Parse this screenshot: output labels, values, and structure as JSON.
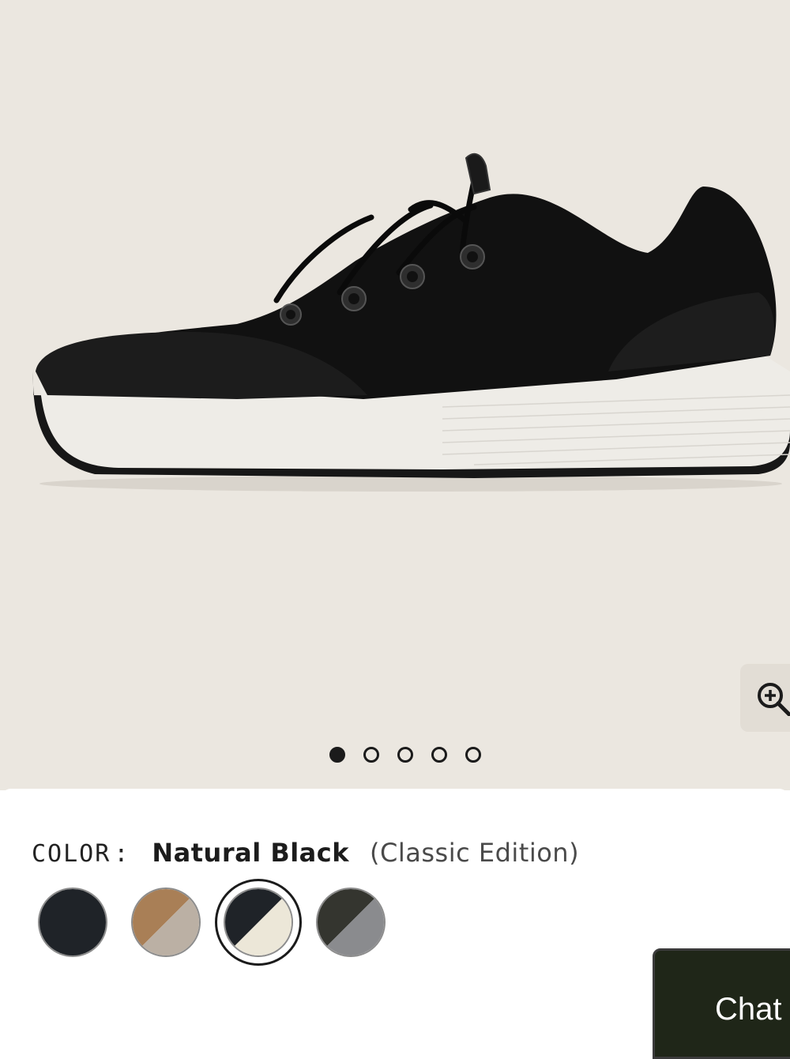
{
  "product": {
    "image": {
      "icon": "sneaker-side-view-image",
      "alt": "Natural Black sneaker"
    },
    "zoom_icon": "zoom-in-icon",
    "carousel": {
      "count": 5,
      "active_index": 1
    }
  },
  "color_selector": {
    "label": "COLOR",
    "separator": ":",
    "selected_name": "Natural Black",
    "selected_edition": "(Classic Edition)",
    "swatches": [
      {
        "colors": [
          "#1f2328"
        ],
        "selected": false
      },
      {
        "colors": [
          "#a97f56",
          "#bbb0a4"
        ],
        "selected": false
      },
      {
        "colors": [
          "#1f2328",
          "#ece7d8"
        ],
        "selected": true
      },
      {
        "colors": [
          "#34352f",
          "#8a8b8e"
        ],
        "selected": false
      }
    ]
  },
  "chat": {
    "label": "Chat"
  },
  "colors": {
    "hero_background": "#ebe7e0",
    "chat_background": "#1f2618",
    "text_primary": "#1c1c1c"
  }
}
